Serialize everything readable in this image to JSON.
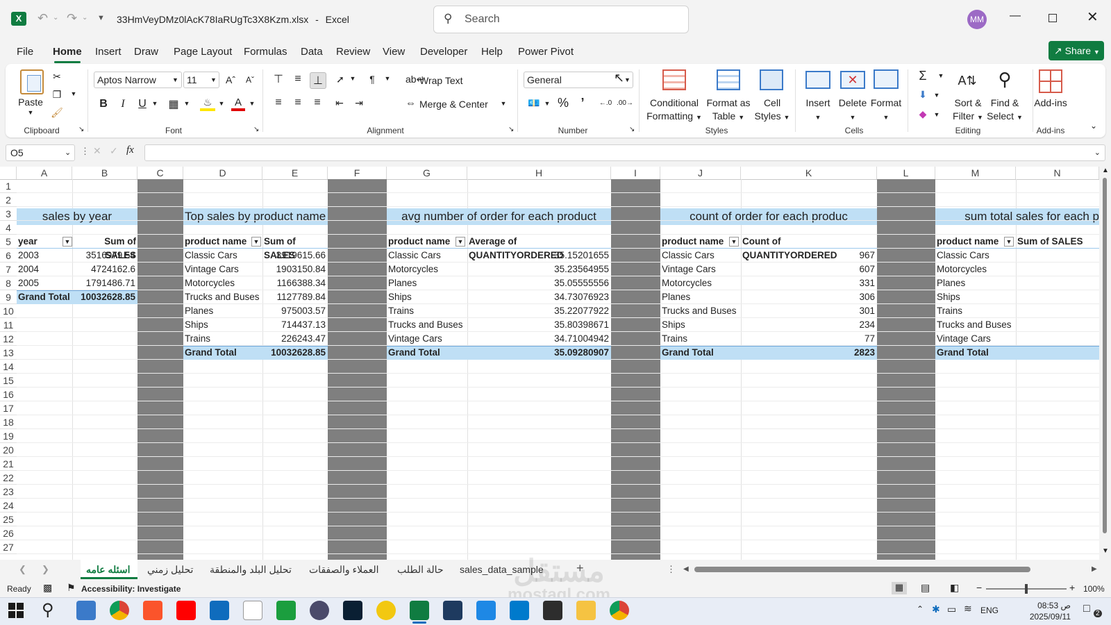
{
  "window": {
    "filename": "33HmVeyDMz0lAcK78IaRUgTc3X8Kzm.xlsx",
    "separator": "-",
    "app": "Excel",
    "search_placeholder": "Search",
    "avatar": "MM"
  },
  "menu": [
    "File",
    "Home",
    "Insert",
    "Draw",
    "Page Layout",
    "Formulas",
    "Data",
    "Review",
    "View",
    "Developer",
    "Help",
    "Power Pivot"
  ],
  "share_label": "Share",
  "ribbon": {
    "clipboard": {
      "paste": "Paste",
      "group": "Clipboard"
    },
    "font": {
      "name": "Aptos Narrow",
      "size": "11",
      "group": "Font",
      "bold": "B",
      "italic": "I",
      "underline": "U"
    },
    "alignment": {
      "wrap": "Wrap Text",
      "merge": "Merge & Center",
      "group": "Alignment"
    },
    "number": {
      "format": "General",
      "group": "Number"
    },
    "styles": {
      "cond1": "Conditional",
      "cond2": "Formatting",
      "fmt1": "Format as",
      "fmt2": "Table",
      "cell1": "Cell",
      "cell2": "Styles",
      "group": "Styles"
    },
    "cells": {
      "insert": "Insert",
      "delete": "Delete",
      "format": "Format",
      "group": "Cells"
    },
    "editing": {
      "sort1": "Sort &",
      "sort2": "Filter",
      "find1": "Find &",
      "find2": "Select",
      "group": "Editing"
    },
    "addins": {
      "label": "Add-ins",
      "group": "Add-ins"
    }
  },
  "formula_bar": {
    "name_box": "O5",
    "fx": "fx",
    "value": ""
  },
  "columns": [
    "A",
    "B",
    "C",
    "D",
    "E",
    "F",
    "G",
    "H",
    "I",
    "J",
    "K",
    "L",
    "M",
    "N"
  ],
  "rows": [
    "1",
    "2",
    "3",
    "4",
    "5",
    "6",
    "7",
    "8",
    "9",
    "10",
    "11",
    "12",
    "13",
    "14",
    "15",
    "16",
    "17",
    "18",
    "19",
    "20",
    "21",
    "22",
    "23",
    "24",
    "25",
    "26",
    "27"
  ],
  "tables": {
    "t1": {
      "title": "sales by year",
      "h1": "year",
      "h2": "Sum of SALES",
      "rows": [
        [
          "2003",
          "3516979.54"
        ],
        [
          "2004",
          "4724162.6"
        ],
        [
          "2005",
          "1791486.71"
        ]
      ],
      "total": [
        "Grand Total",
        "10032628.85"
      ]
    },
    "t2": {
      "title": "Top sales by product name",
      "h1": "product name",
      "h2": "Sum of SALES",
      "rows": [
        [
          "Classic Cars",
          "3919615.66"
        ],
        [
          "Vintage Cars",
          "1903150.84"
        ],
        [
          "Motorcycles",
          "1166388.34"
        ],
        [
          "Trucks and Buses",
          "1127789.84"
        ],
        [
          "Planes",
          "975003.57"
        ],
        [
          "Ships",
          "714437.13"
        ],
        [
          "Trains",
          "226243.47"
        ]
      ],
      "total": [
        "Grand Total",
        "10032628.85"
      ]
    },
    "t3": {
      "title": "avg number of order for each product",
      "h1": "product name",
      "h2": "Average of QUANTITYORDERED",
      "rows": [
        [
          "Classic Cars",
          "35.15201655"
        ],
        [
          "Motorcycles",
          "35.23564955"
        ],
        [
          "Planes",
          "35.05555556"
        ],
        [
          "Ships",
          "34.73076923"
        ],
        [
          "Trains",
          "35.22077922"
        ],
        [
          "Trucks and Buses",
          "35.80398671"
        ],
        [
          "Vintage Cars",
          "34.71004942"
        ]
      ],
      "total": [
        "Grand Total",
        "35.09280907"
      ]
    },
    "t4": {
      "title": "count of order for each produc",
      "h1": "product name",
      "h2": "Count of QUANTITYORDERED",
      "rows": [
        [
          "Classic Cars",
          "967"
        ],
        [
          "Vintage Cars",
          "607"
        ],
        [
          "Motorcycles",
          "331"
        ],
        [
          "Planes",
          "306"
        ],
        [
          "Trucks and Buses",
          "301"
        ],
        [
          "Ships",
          "234"
        ],
        [
          "Trains",
          "77"
        ]
      ],
      "total": [
        "Grand Total",
        "2823"
      ]
    },
    "t5": {
      "title": "sum total sales for each p",
      "h1": "product name",
      "h2": "Sum of SALES",
      "rows": [
        [
          "Classic Cars"
        ],
        [
          "Motorcycles"
        ],
        [
          "Planes"
        ],
        [
          "Ships"
        ],
        [
          "Trains"
        ],
        [
          "Trucks and Buses"
        ],
        [
          "Vintage Cars"
        ]
      ],
      "total": [
        "Grand Total"
      ]
    }
  },
  "sheet_tabs": [
    "اسئله عامه",
    "تحليل زمني",
    "تحليل البلد والمنطقة",
    "العملاء والصفقات",
    "حالة الطلب",
    "sales_data_sample"
  ],
  "add_sheet": "+",
  "status": {
    "ready": "Ready",
    "accessibility": "Accessibility: Investigate",
    "zoom": "100%"
  },
  "taskbar": {
    "lang": "ENG",
    "time": "08:53",
    "ampm": "ص",
    "date": "2025/09/11",
    "notif": "2"
  },
  "watermark": {
    "line1": "مستقل",
    "line2": "mostaql.com"
  }
}
